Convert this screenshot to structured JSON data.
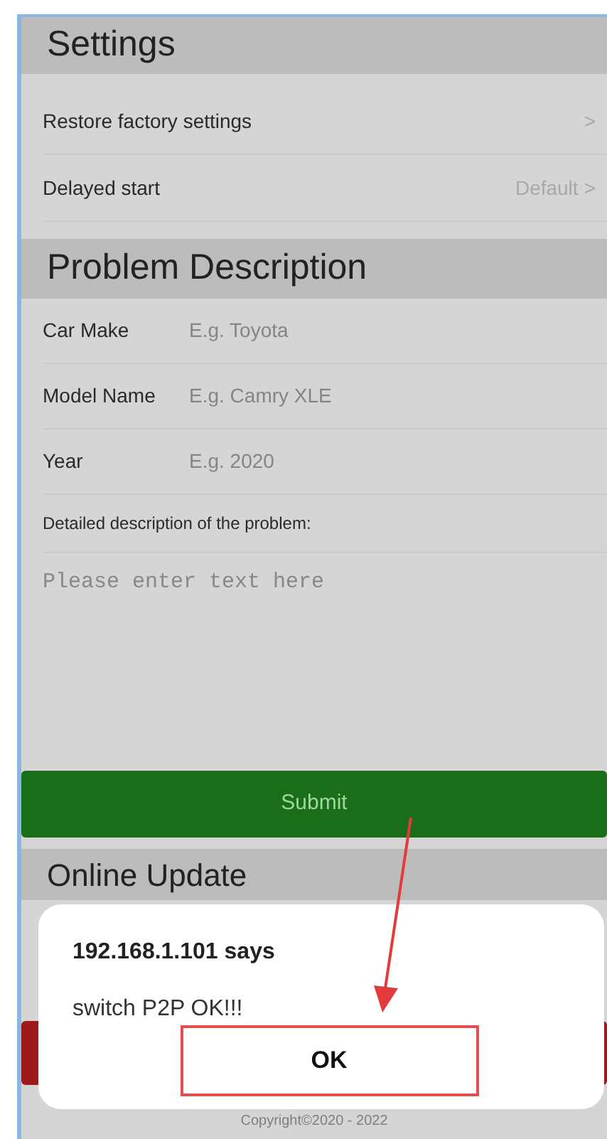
{
  "settings": {
    "title": "Settings",
    "items": [
      {
        "label": "Restore factory settings",
        "chevron": ">"
      },
      {
        "label": "Delayed start",
        "value": "Default",
        "chevron": ">"
      }
    ]
  },
  "problem": {
    "title": "Problem Description",
    "fields": [
      {
        "label": "Car Make",
        "placeholder": "E.g. Toyota"
      },
      {
        "label": "Model Name",
        "placeholder": "E.g. Camry XLE"
      },
      {
        "label": "Year",
        "placeholder": "E.g. 2020"
      }
    ],
    "description_label": "Detailed description of the problem:",
    "description_placeholder": "Please enter text here",
    "submit": "Submit"
  },
  "online_update": {
    "title": "Online Update",
    "copyright": "Copyright©2020 - 2022"
  },
  "dialog": {
    "title": "192.168.1.101 says",
    "message": "switch P2P OK!!!",
    "button": "OK"
  }
}
